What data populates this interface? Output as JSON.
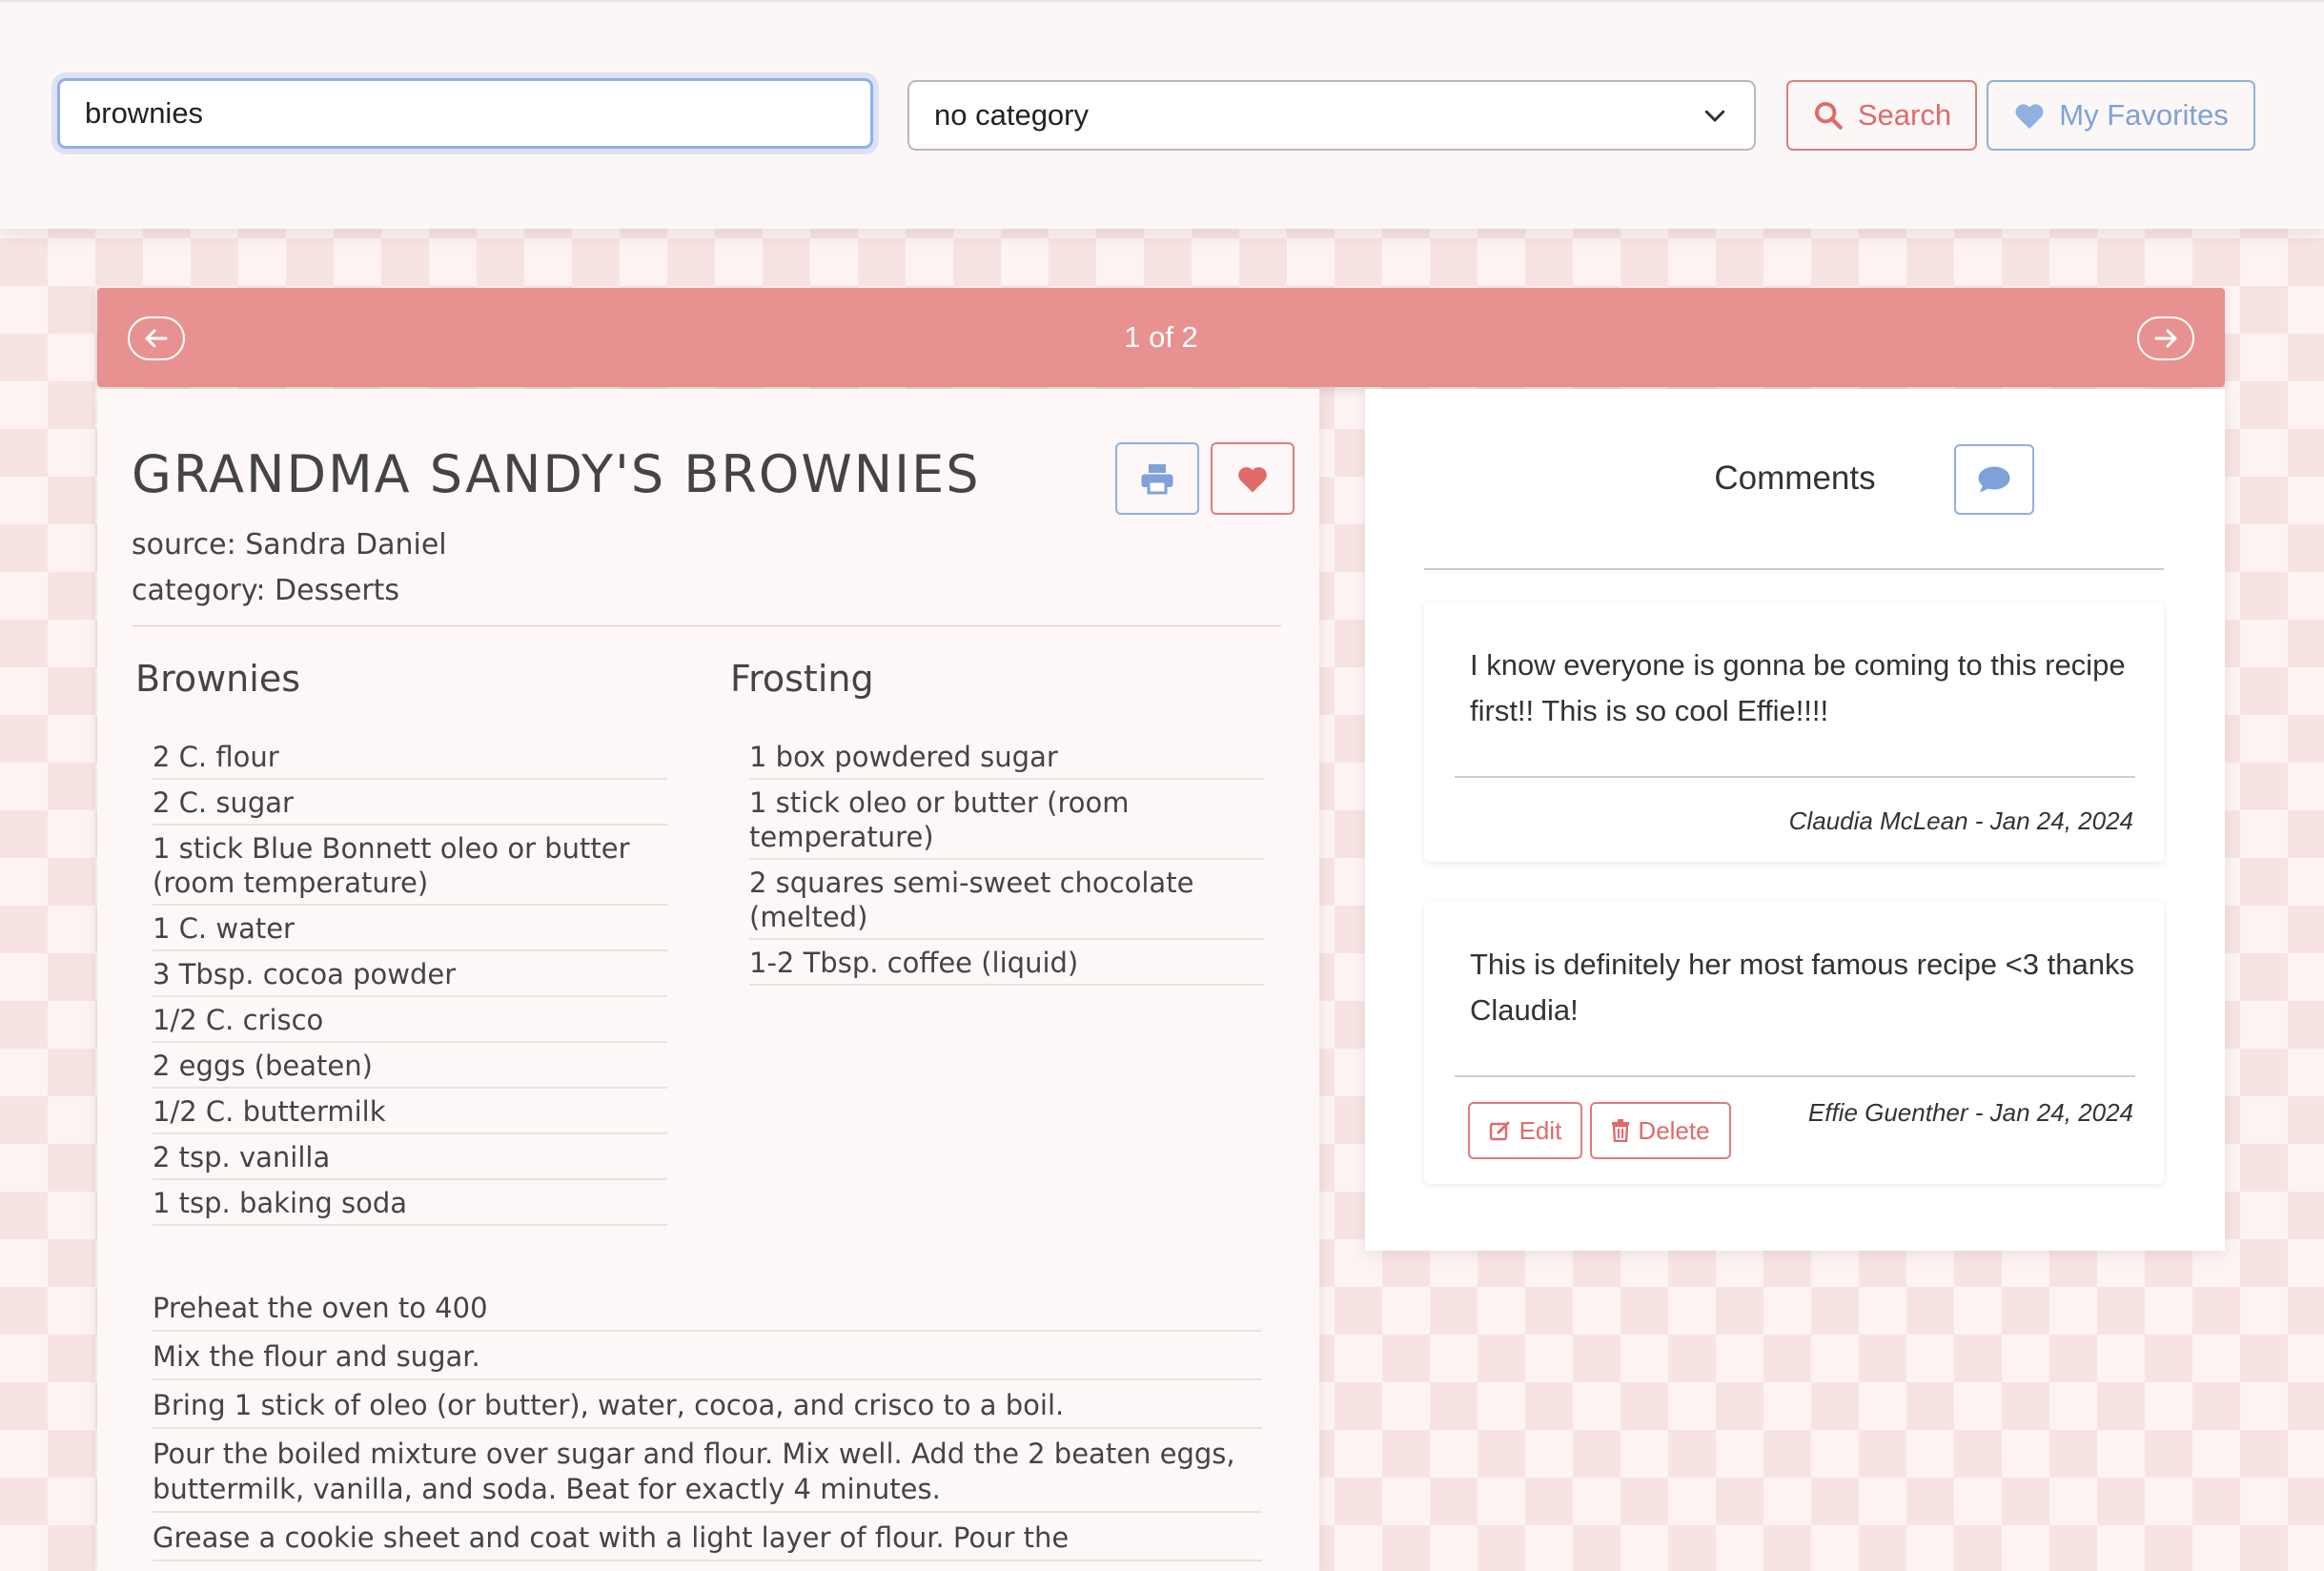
{
  "search": {
    "query": "brownies",
    "category": "no category",
    "search_label": "Search",
    "favorites_label": "My Favorites"
  },
  "pager": {
    "text": "1 of 2"
  },
  "recipe": {
    "title": "GRANDMA SANDY'S BROWNIES",
    "source": "source: Sandra Daniel",
    "category": "category: Desserts",
    "sections": [
      {
        "title": "Brownies",
        "ingredients": [
          "2 C. flour",
          "2 C. sugar",
          "1 stick Blue Bonnett oleo or butter (room temperature)",
          "1 C. water",
          "3 Tbsp. cocoa powder",
          "1/2 C. crisco",
          "2 eggs (beaten)",
          "1/2 C. buttermilk",
          "2 tsp. vanilla",
          "1 tsp. baking soda"
        ]
      },
      {
        "title": "Frosting",
        "ingredients": [
          "1 box powdered sugar",
          "1 stick oleo or butter (room temperature)",
          "2 squares semi-sweet chocolate (melted)",
          "1-2 Tbsp. coffee (liquid)"
        ]
      }
    ],
    "directions": [
      "Preheat the oven to 400",
      "Mix the flour and sugar.",
      "Bring 1 stick of oleo (or butter), water, cocoa, and crisco to a boil.",
      "Pour the boiled mixture over sugar and flour. Mix well. Add the 2 beaten eggs, buttermilk, vanilla, and soda. Beat for exactly 4 minutes.",
      "Grease a cookie sheet and coat with a light layer of flour. Pour the"
    ]
  },
  "comments": {
    "title": "Comments",
    "items": [
      {
        "text": "I know everyone is gonna be coming to this recipe first!! This is so cool Effie!!!!",
        "author": "Claudia McLean - Jan 24, 2024"
      },
      {
        "text": "This is definitely her most famous recipe <3 thanks Claudia!",
        "author": "Effie Guenther - Jan 24, 2024",
        "edit_label": "Edit",
        "delete_label": "Delete"
      }
    ]
  },
  "colors": {
    "accent": "#e89191",
    "blue": "#8fb0e0",
    "red": "#e06a6a"
  },
  "icons": [
    "search-icon",
    "heart-icon",
    "chevron-down-icon",
    "arrow-left-icon",
    "arrow-right-icon",
    "print-icon",
    "comment-icon",
    "edit-icon",
    "trash-icon"
  ]
}
